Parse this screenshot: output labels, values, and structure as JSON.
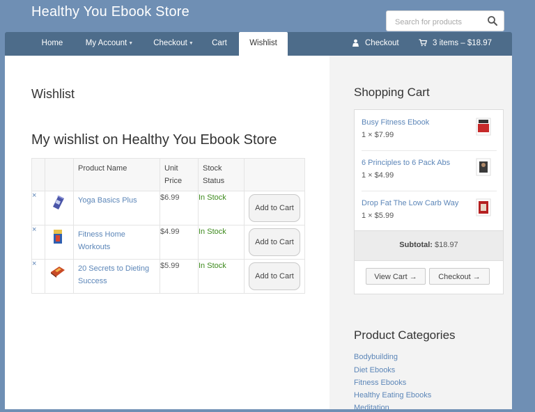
{
  "site": {
    "title": "Healthy You Ebook Store"
  },
  "search": {
    "placeholder": "Search for products",
    "icon": "search-icon"
  },
  "nav": {
    "items": [
      {
        "label": "Home"
      },
      {
        "label": "My Account",
        "caret": "▼"
      },
      {
        "label": "Checkout",
        "caret": "▼"
      },
      {
        "label": "Cart"
      },
      {
        "label": "Wishlist",
        "active": true
      }
    ],
    "checkout_label": "Checkout",
    "cart_summary": "3 items – $18.97"
  },
  "page": {
    "title": "Wishlist",
    "wishlist_heading": "My wishlist on Healthy You Ebook Store"
  },
  "table": {
    "headers": {
      "name": "Product Name",
      "unit_price": "Unit Price",
      "stock": "Stock Status"
    },
    "remove_symbol": "×",
    "rows": [
      {
        "name": "Yoga Basics Plus",
        "price": "$6.99",
        "stock": "In Stock",
        "action": "Add to Cart"
      },
      {
        "name": "Fitness Home Workouts",
        "price": "$4.99",
        "stock": "In Stock",
        "action": "Add to Cart"
      },
      {
        "name": "20 Secrets to Dieting Success",
        "price": "$5.99",
        "stock": "In Stock",
        "action": "Add to Cart"
      }
    ]
  },
  "cart": {
    "title": "Shopping Cart",
    "items": [
      {
        "name": "Busy Fitness Ebook",
        "qty": "1 × $7.99"
      },
      {
        "name": "6 Principles to 6 Pack Abs",
        "qty": "1 × $4.99"
      },
      {
        "name": "Drop Fat The Low Carb Way",
        "qty": "1 × $5.99"
      }
    ],
    "subtotal_label": "Subtotal:",
    "subtotal_value": "$18.97",
    "view_cart": "View Cart →",
    "checkout": "Checkout →"
  },
  "categories": {
    "title": "Product Categories",
    "items": [
      "Bodybuilding",
      "Diet Ebooks",
      "Fitness Ebooks",
      "Healthy Eating Ebooks",
      "Meditation"
    ]
  },
  "colors": {
    "nav_bg": "#4d6c8a",
    "page_bg": "#6f8fb4",
    "link": "#5c86b8",
    "in_stock": "#3d8a1d"
  }
}
